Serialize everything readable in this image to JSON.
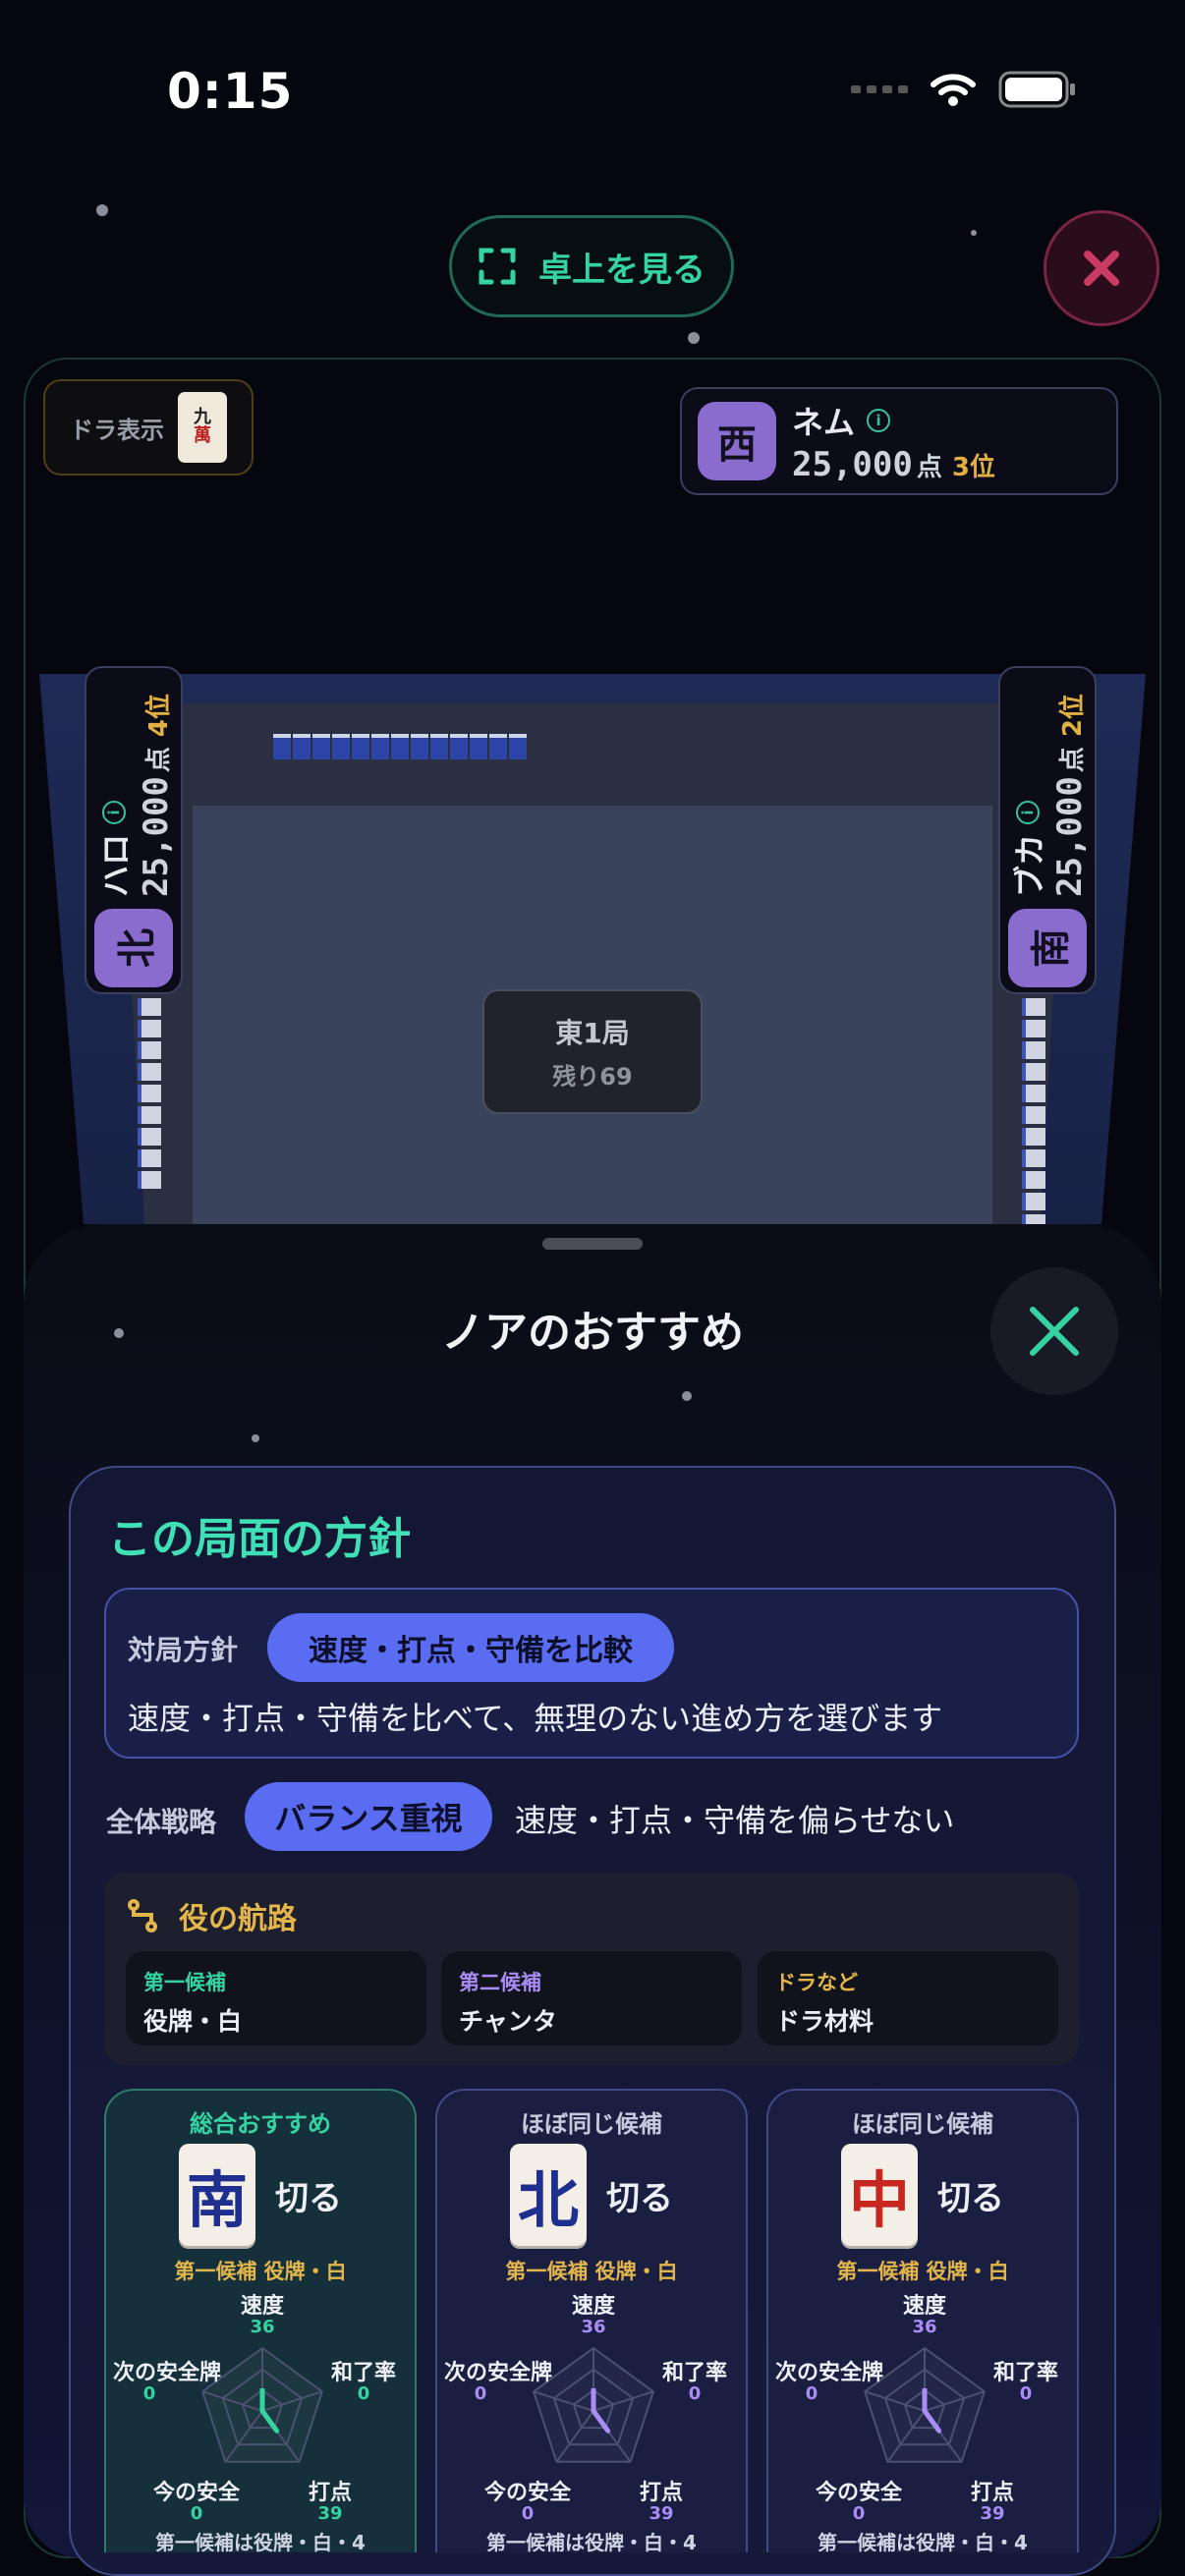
{
  "status_bar": {
    "time": "0:15"
  },
  "top": {
    "view_table_label": "卓上を見る"
  },
  "dora": {
    "label": "ドラ表示",
    "tile_top": "九",
    "tile_bottom": "萬"
  },
  "players": {
    "top": {
      "wind": "西",
      "name": "ネム",
      "score": "25,000",
      "unit": "点",
      "rank": "3位"
    },
    "left": {
      "wind": "北",
      "name": "ハロ",
      "score": "25,000",
      "unit": "点",
      "rank": "4位"
    },
    "right": {
      "wind": "南",
      "name": "ブカ",
      "score": "25,000",
      "unit": "点",
      "rank": "2位"
    }
  },
  "round": {
    "name": "東1局",
    "remaining": "残り69"
  },
  "sheet": {
    "title": "ノアのおすすめ",
    "policy_title": "この局面の方針",
    "match_policy_label": "対局方針",
    "match_policy_chip": "速度・打点・守備を比較",
    "match_policy_desc": "速度・打点・守備を比べて、無理のない進め方を選びます",
    "strategy_label": "全体戦略",
    "strategy_chip": "バランス重視",
    "strategy_desc": "速度・打点・守備を偏らせない",
    "route_title": "役の航路",
    "routes": [
      {
        "sub": "第一候補",
        "value": "役牌・白",
        "color": "#34d3a1"
      },
      {
        "sub": "第二候補",
        "value": "チャンタ",
        "color": "#a98cf5"
      },
      {
        "sub": "ドラなど",
        "value": "ドラ材料",
        "color": "#e3b64b"
      }
    ],
    "candidates": [
      {
        "head": "総合おすすめ",
        "tile": "南",
        "action": "切る",
        "note": "第一候補 役牌・白",
        "foot": "第一候補は役牌・白・4",
        "radar_labels": {
          "speed": "速度",
          "winrate": "和了率",
          "points": "打点",
          "safety_now": "今の安全",
          "next_safe": "次の安全牌"
        },
        "radar_values": {
          "speed": 36,
          "winrate": 0,
          "points": 39,
          "safety_now": 0,
          "next_safe": 0
        }
      },
      {
        "head": "ほぼ同じ候補",
        "tile": "北",
        "action": "切る",
        "note": "第一候補 役牌・白",
        "foot": "第一候補は役牌・白・4",
        "radar_labels": {
          "speed": "速度",
          "winrate": "和了率",
          "points": "打点",
          "safety_now": "今の安全",
          "next_safe": "次の安全牌"
        },
        "radar_values": {
          "speed": 36,
          "winrate": 0,
          "points": 39,
          "safety_now": 0,
          "next_safe": 0
        }
      },
      {
        "head": "ほぼ同じ候補",
        "tile": "中",
        "action": "切る",
        "note": "第一候補 役牌・白",
        "foot": "第一候補は役牌・白・4",
        "radar_labels": {
          "speed": "速度",
          "winrate": "和了率",
          "points": "打点",
          "safety_now": "今の安全",
          "next_safe": "次の安全牌"
        },
        "radar_values": {
          "speed": 36,
          "winrate": 0,
          "points": 39,
          "safety_now": 0,
          "next_safe": 0
        }
      }
    ]
  },
  "colors": {
    "accent": "#34d3a1",
    "chip": "#5a6cf2",
    "gold": "#e3b64b",
    "purple": "#a98cf5",
    "close_red": "#c93a64"
  }
}
